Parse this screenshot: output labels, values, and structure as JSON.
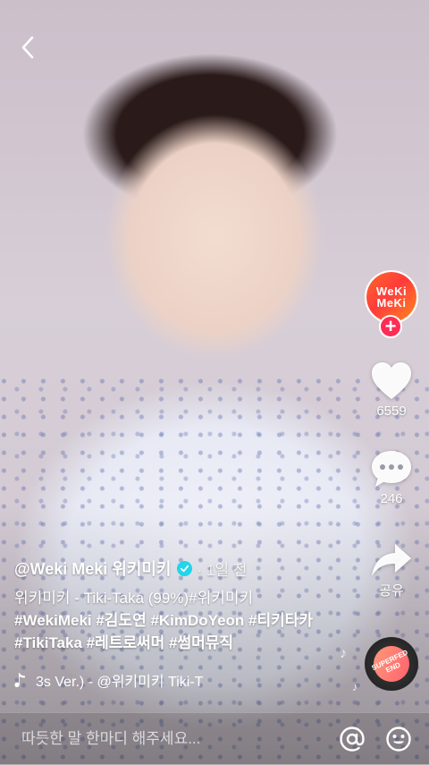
{
  "author": {
    "handle": "@Weki Meki 위키미키",
    "time": "· 1일 전"
  },
  "avatar": {
    "line1": "WeKi",
    "line2": "MeKi"
  },
  "actions": {
    "likes": "6559",
    "comments": "246",
    "share": "공유"
  },
  "caption": {
    "text": "위키미키 - Tiki-Taka (99%)#위키미키",
    "tags": "#WekiMeki #김도연 #KimDoYeon #티키타카 #TikiTaka #레트로써머 #썸머뮤직"
  },
  "music": {
    "text": "3s Ver.)  - @위키미키    Tiki-T"
  },
  "disc": {
    "label": "SUPERFED END"
  },
  "comment_bar": {
    "placeholder": "따듯한 말 한마디 해주세요..."
  },
  "icons": {
    "back": "chevron-left-icon",
    "like": "heart-icon",
    "comment": "speech-bubble-icon",
    "share": "share-arrow-icon",
    "music": "music-note-icon",
    "mention": "at-sign-icon",
    "emoji": "smiley-icon",
    "verified": "verified-check-icon"
  },
  "colors": {
    "accent": "#fe2c55",
    "verified": "#20d5ec",
    "text": "#ffffff"
  }
}
